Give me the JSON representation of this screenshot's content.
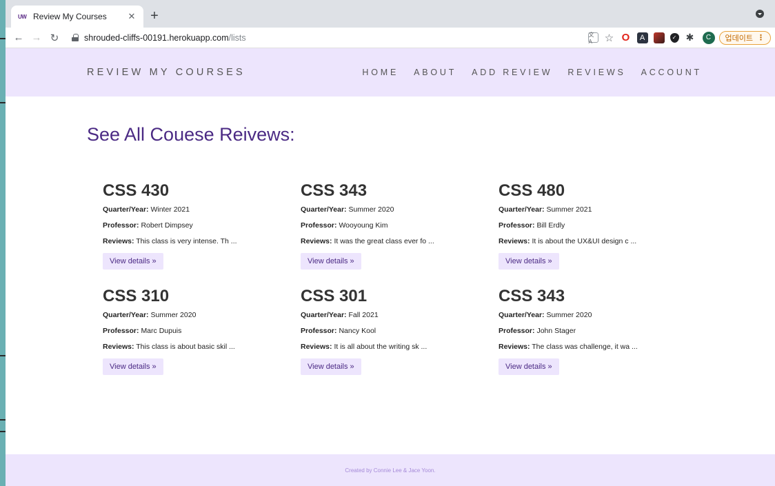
{
  "browser": {
    "tab_title": "Review My Courses",
    "tab_favicon": "UW",
    "url_host": "shrouded-cliffs-00191.herokuapp.com",
    "url_path": "/lists",
    "profile_initial": "C",
    "update_label": "업데이트"
  },
  "site": {
    "brand": "REVIEW MY COURSES",
    "nav": [
      "HOME",
      "ABOUT",
      "ADD REVIEW",
      "REVIEWS",
      "ACCOUNT"
    ],
    "accent_color": "#4b2a84",
    "header_bg": "#ede5fd"
  },
  "page": {
    "title": "See All Couese Reivews:",
    "labels": {
      "quarter": "Quarter/Year:",
      "professor": "Professor:",
      "reviews": "Reviews:",
      "details": "View details »"
    },
    "courses": [
      {
        "code": "CSS 430",
        "quarter": "Winter 2021",
        "professor": "Robert Dimpsey",
        "review": "This class is very intense. Th ..."
      },
      {
        "code": "CSS 343",
        "quarter": "Summer 2020",
        "professor": "Wooyoung Kim",
        "review": "It was the great class ever fo ..."
      },
      {
        "code": "CSS 480",
        "quarter": "Summer 2021",
        "professor": "Bill Erdly",
        "review": "It is about the UX&UI design c ..."
      },
      {
        "code": "CSS 310",
        "quarter": "Summer 2020",
        "professor": "Marc Dupuis",
        "review": "This class is about basic skil ..."
      },
      {
        "code": "CSS 301",
        "quarter": "Fall 2021",
        "professor": "Nancy Kool",
        "review": "It is all about the writing sk ..."
      },
      {
        "code": "CSS 343",
        "quarter": "Summer 2020",
        "professor": "John Stager",
        "review": "The class was challenge, it wa ..."
      }
    ]
  },
  "footer": {
    "text": "Created by Connie Lee & Jace Yoon."
  }
}
